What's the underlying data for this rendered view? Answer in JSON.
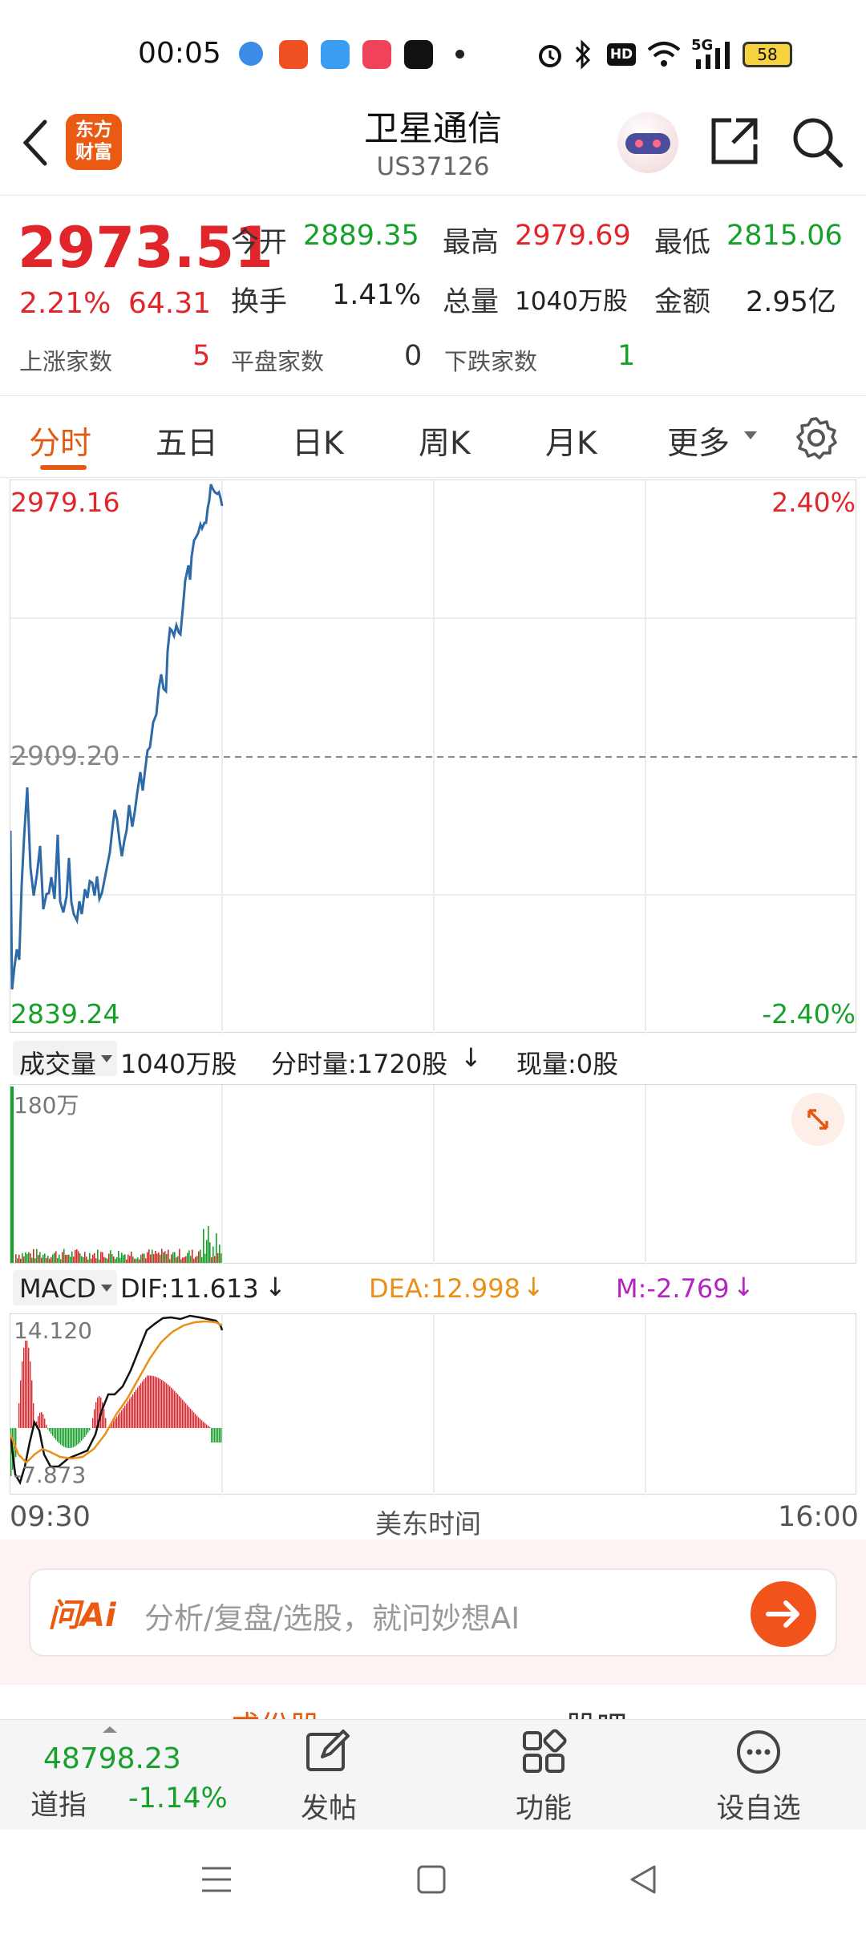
{
  "status_bar": {
    "time": "00:05",
    "battery": "58",
    "network": "5G",
    "hd": "HD",
    "icons": [
      "app1-icon",
      "app2-icon",
      "weather-icon",
      "music-icon",
      "tiktok-icon",
      "dot-icon",
      "alarm-icon",
      "bluetooth-icon",
      "hd-icon",
      "wifi-icon",
      "signal-icon",
      "battery-icon"
    ]
  },
  "header": {
    "back": "back-icon",
    "logo_text_1": "东方",
    "logo_text_2": "财富",
    "title": "卫星通信",
    "code": "US37126"
  },
  "quote": {
    "price": "2973.51",
    "change_pct": "2.21%",
    "change": "64.31",
    "open_label": "今开",
    "open": "2889.35",
    "high_label": "最高",
    "high": "2979.69",
    "low_label": "最低",
    "low": "2815.06",
    "turnover_label": "换手",
    "turnover": "1.41%",
    "volume_label": "总量",
    "volume": "1040万股",
    "amount_label": "金额",
    "amount": "2.95亿",
    "up_label": "上涨家数",
    "up": "5",
    "flat_label": "平盘家数",
    "flat": "0",
    "down_label": "下跌家数",
    "down": "1"
  },
  "tabs": [
    "分时",
    "五日",
    "日K",
    "周K",
    "月K",
    "更多"
  ],
  "intraday": {
    "top_price": "2979.16",
    "top_pct": "2.40%",
    "mid_price": "2909.20",
    "bottom_price": "2839.24",
    "bottom_pct": "-2.40%"
  },
  "volume_bar": {
    "selector": "成交量",
    "total": "1040万股",
    "minute_vol": "分时量:1720股",
    "current_vol": "现量:0股",
    "axis_max": "180万"
  },
  "macd": {
    "selector": "MACD",
    "dif": "DIF:11.613",
    "dea": "DEA:12.998",
    "m": "M:-2.769",
    "axis_max": "14.120",
    "axis_min": "-7.873"
  },
  "time_axis": {
    "start": "09:30",
    "mid": "美东时间",
    "end": "16:00"
  },
  "ai": {
    "brand": "问Ai",
    "placeholder": "分析/复盘/选股，就问妙想AI"
  },
  "partial_tabs": [
    "成份股",
    "股吧"
  ],
  "bottom_nav": {
    "index_value": "48798.23",
    "index_name": "道指",
    "index_change": "-1.14%",
    "post": "发帖",
    "func": "功能",
    "watch": "设自选"
  },
  "colors": {
    "accent": "#e25b13",
    "up": "#e0262b",
    "down": "#17a02a",
    "line": "#2e6aa8",
    "dea": "#e8901a",
    "m": "#b524c2"
  }
}
